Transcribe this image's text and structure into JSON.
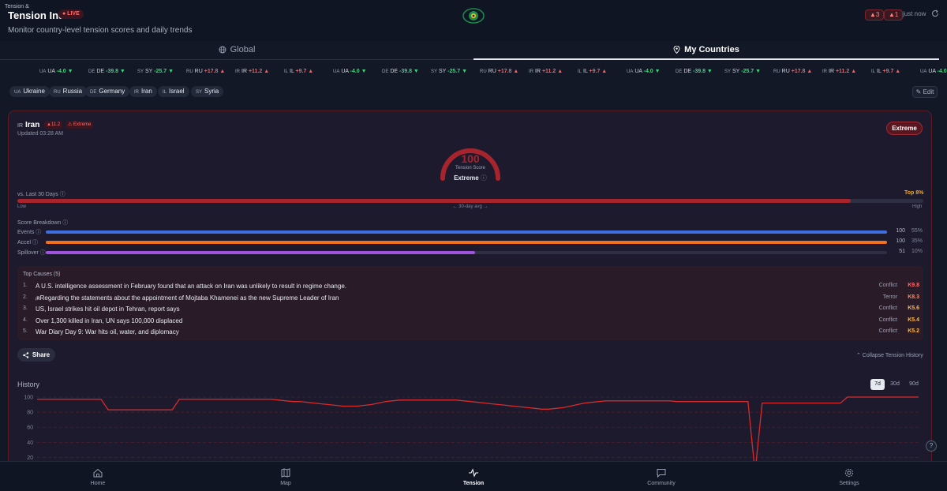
{
  "header": {
    "title": "Tension Index",
    "live_badge": "● LIVE",
    "subtitle": "Monitor country-level tension scores and daily trends",
    "alert_a": "▲3",
    "alert_b": "▲1",
    "updated": "just now"
  },
  "tabs": [
    {
      "label": "Global",
      "icon": "globe-icon",
      "active": false
    },
    {
      "label": "My Countries",
      "icon": "pin-icon",
      "active": true
    }
  ],
  "ticker": {
    "label": "Tension &",
    "items": [
      {
        "code": "UA",
        "name": "UA",
        "delta": "-4.0",
        "dir": "down"
      },
      {
        "code": "DE",
        "name": "DE",
        "delta": "-39.8",
        "dir": "down"
      },
      {
        "code": "SY",
        "name": "SY",
        "delta": "-25.7",
        "dir": "down"
      },
      {
        "code": "RU",
        "name": "RU",
        "delta": "+17.8",
        "dir": "up"
      },
      {
        "code": "IR",
        "name": "IR",
        "delta": "+11.2",
        "dir": "up"
      },
      {
        "code": "IL",
        "name": "IL",
        "delta": "+9.7",
        "dir": "up"
      }
    ]
  },
  "chips": [
    {
      "code": "UA",
      "label": "Ukraine"
    },
    {
      "code": "RU",
      "label": "Russia"
    },
    {
      "code": "DE",
      "label": "Germany"
    },
    {
      "code": "IR",
      "label": "Iran"
    },
    {
      "code": "IL",
      "label": "Israel"
    },
    {
      "code": "SY",
      "label": "Syria"
    }
  ],
  "edit_label": "✎ Edit",
  "card": {
    "code": "IR",
    "name": "Iran",
    "delta": "▲11.2",
    "level_badge": "⚠ Extreme",
    "updated": "Updated 03:28 AM",
    "level_pill": "Extreme",
    "score": "100",
    "score_label": "Tension Score",
    "score_level": "Extreme",
    "gauge_fraction": 1.0,
    "vs_label": "vs. Last 30 Days",
    "vs_top": "Top 8%",
    "vs_fraction": 0.92,
    "vs_low": "Low",
    "vs_avg": "← 30-day avg →",
    "vs_high": "High",
    "breakdown_label": "Score Breakdown",
    "breakdown": [
      {
        "name": "Events",
        "value": "100",
        "fraction": 1.0,
        "pct": "55%",
        "color": "#3e6fe0"
      },
      {
        "name": "Accel",
        "value": "100",
        "fraction": 1.0,
        "pct": "35%",
        "color": "#f07020"
      },
      {
        "name": "Spillover",
        "value": "51",
        "fraction": 0.51,
        "pct": "10%",
        "color": "#a052e0"
      }
    ],
    "causes_title": "Top Causes (5)",
    "causes": [
      {
        "n": "1.",
        "text": "A U.S. intelligence assessment in February found that an attack on Iran was unlikely to result in regime change.",
        "category": "Conflict",
        "score": "K9.8",
        "color": "#ff6b6b"
      },
      {
        "n": "2.",
        "text": "ᵢʀRegarding the statements about the appointment of Mojtaba Khamenei as the new Supreme Leader of Iran",
        "category": "Terror",
        "score": "K8.3",
        "color": "#ff8a5c"
      },
      {
        "n": "3.",
        "text": "US, Israel strikes hit oil depot in Tehran, report says",
        "category": "Conflict",
        "score": "K5.6",
        "color": "#ffb84d"
      },
      {
        "n": "4.",
        "text": "Over 1,300 killed in Iran, UN says 100,000 displaced",
        "category": "Conflict",
        "score": "K5.4",
        "color": "#ffb84d"
      },
      {
        "n": "5.",
        "text": "War Diary Day 9: War hits oil, water, and diplomacy",
        "category": "Conflict",
        "score": "K5.2",
        "color": "#ffb84d"
      }
    ],
    "share_label": "Share",
    "collapse_label": "⌃ Collapse Tension History",
    "history_title": "History",
    "ranges": [
      {
        "label": "7d",
        "active": true
      },
      {
        "label": "30d",
        "active": false
      },
      {
        "label": "90d",
        "active": false
      }
    ]
  },
  "chart_data": {
    "type": "line",
    "ylim": [
      0,
      100
    ],
    "y_ticks": [
      "100",
      "80",
      "60",
      "40",
      "20"
    ],
    "series": [
      {
        "color": "#d92b2b",
        "values": [
          97,
          97,
          97,
          97,
          97,
          97,
          97,
          97,
          97,
          97,
          83,
          83,
          83,
          83,
          83,
          83,
          83,
          83,
          83,
          83,
          97,
          97,
          97,
          97,
          97,
          97,
          97,
          97,
          97,
          97,
          97,
          97,
          97,
          97,
          96,
          95,
          94,
          94,
          93,
          92,
          91,
          90,
          89,
          88,
          88,
          88,
          89,
          90,
          92,
          94,
          95,
          96,
          96,
          96,
          96,
          96,
          96,
          96,
          96,
          96,
          95,
          94,
          93,
          92,
          91,
          90,
          89,
          88,
          87,
          86,
          85,
          84,
          84,
          85,
          86,
          88,
          90,
          92,
          93,
          94,
          95,
          95,
          95,
          95,
          95,
          95,
          95,
          95,
          95,
          95,
          94,
          94,
          94,
          94,
          94,
          94,
          94,
          94,
          94,
          94,
          94,
          0,
          92,
          92,
          92,
          92,
          92,
          92,
          92,
          92,
          92,
          92,
          92,
          92,
          100,
          100,
          100,
          100,
          100,
          100,
          100,
          100,
          100,
          100,
          100
        ]
      }
    ]
  },
  "nav": [
    {
      "label": "Home",
      "icon": "home-icon",
      "active": false
    },
    {
      "label": "Map",
      "icon": "map-icon",
      "active": false
    },
    {
      "label": "Tension",
      "icon": "pulse-icon",
      "active": true
    },
    {
      "label": "Community",
      "icon": "chat-icon",
      "active": false
    },
    {
      "label": "Settings",
      "icon": "gear-icon",
      "active": false
    }
  ],
  "help_label": "?"
}
